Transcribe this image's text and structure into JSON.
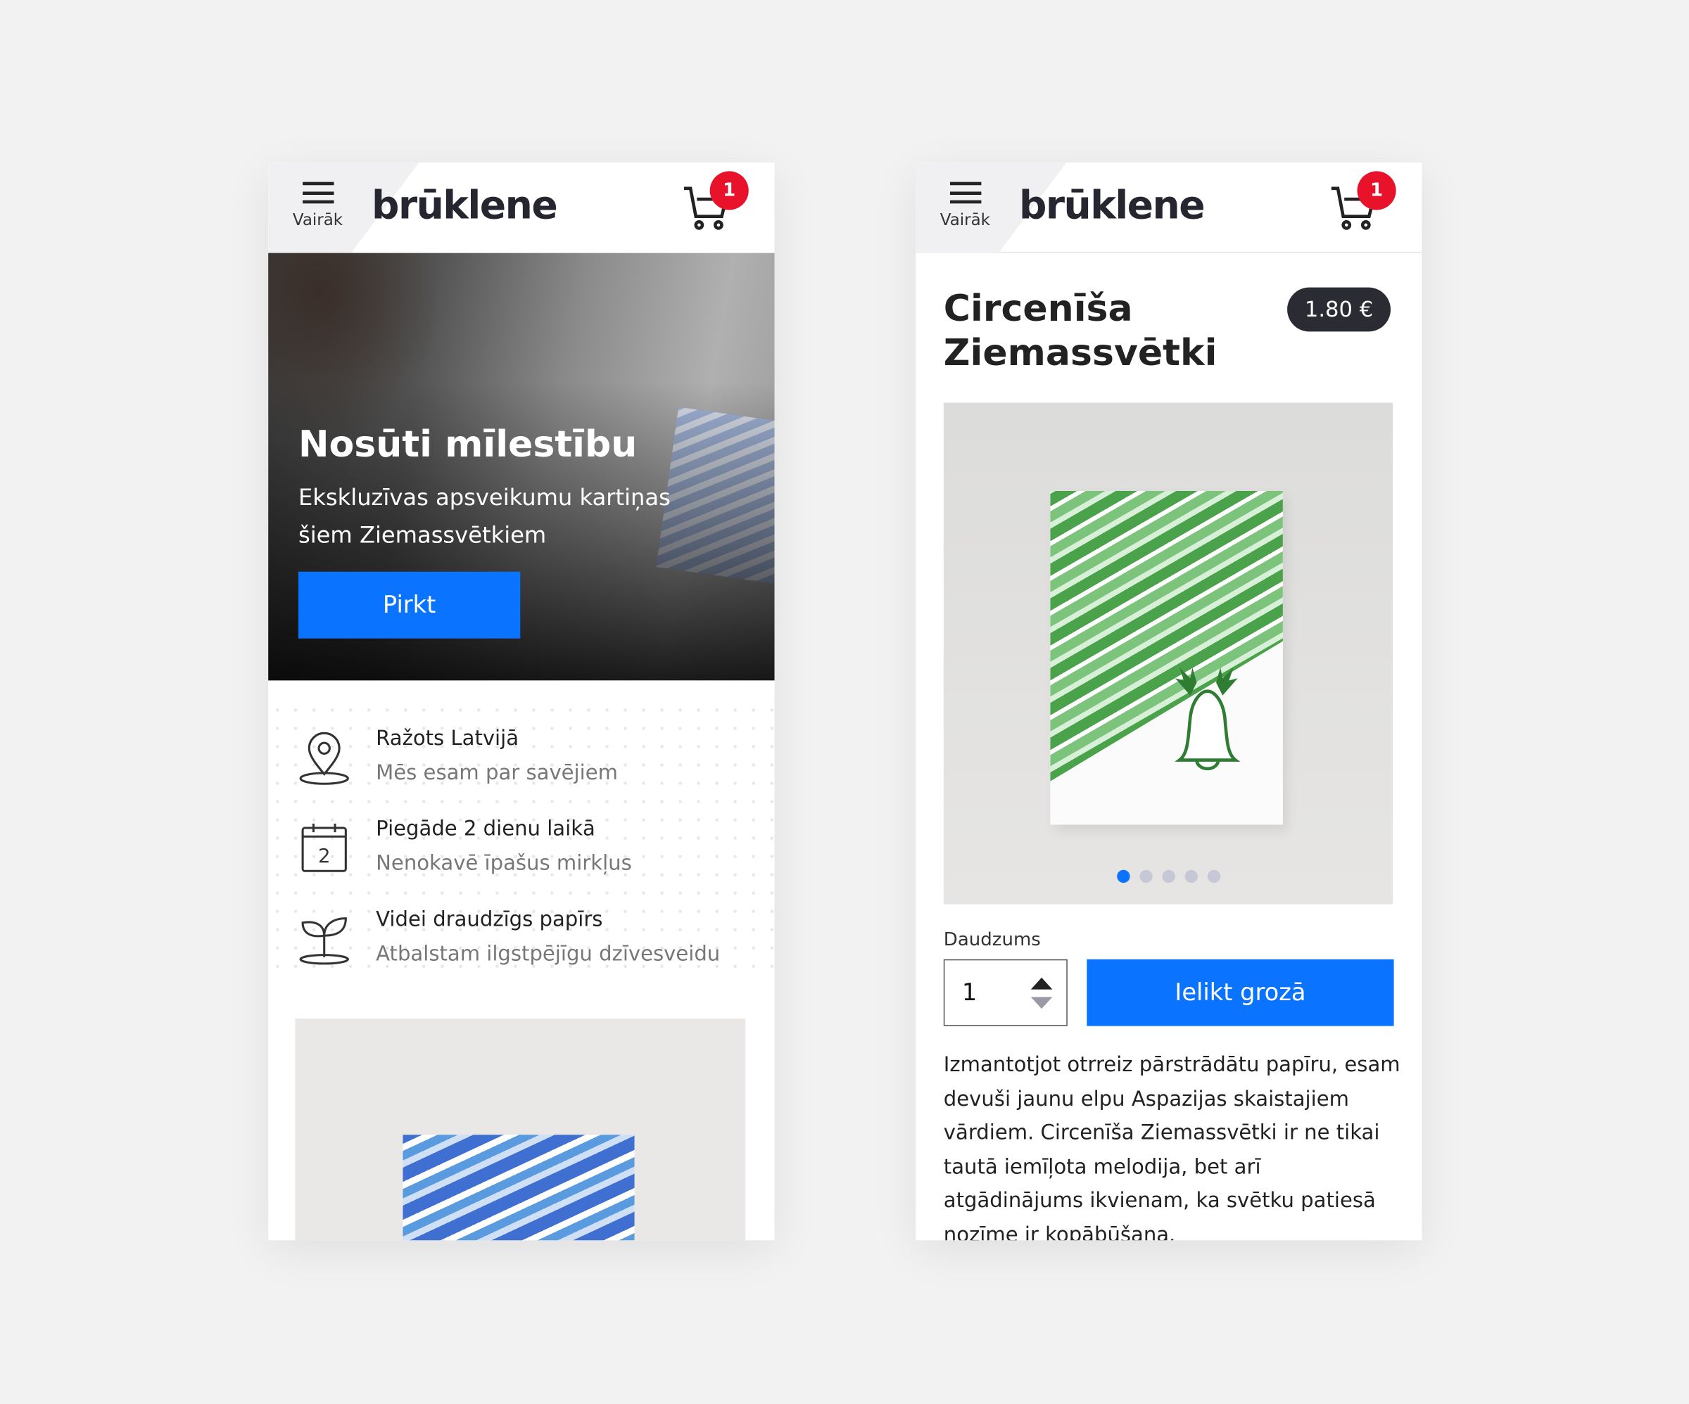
{
  "header": {
    "menu_label": "Vairāk",
    "logo": "brūklene",
    "cart_count": "1"
  },
  "home": {
    "hero": {
      "title": "Nosūti mīlestību",
      "subtitle": "Ekskluzīvas apsveikumu kartiņas šiem Ziemassvētkiem",
      "button": "Pirkt"
    },
    "features": [
      {
        "icon": "location-pin-icon",
        "title": "Ražots Latvijā",
        "desc": "Mēs esam par savējiem"
      },
      {
        "icon": "calendar-icon",
        "title": "Piegāde 2 dienu laikā",
        "desc": "Nenokavē īpašus mirkļus",
        "calendar_day": "2"
      },
      {
        "icon": "sprout-icon",
        "title": "Videi draudzīgs papīrs",
        "desc": "Atbalstam ilgstpējīgu dzīvesveidu"
      }
    ]
  },
  "product": {
    "title": "Circenīša Ziemassvētki",
    "price": "1.80 €",
    "gallery": {
      "count": 5,
      "active": 0
    },
    "quantity_label": "Daudzums",
    "quantity": "1",
    "add_button": "Ielikt grozā",
    "description": "Izmantotjot otrreiz pārstrādātu papīru, esam devuši jaunu elpu Aspazijas skaistajiem vārdiem. Circenīša Ziemassvētki ir ne tikai tautā iemīļota melodija, bet arī atgādinājums ikvienam, ka svētku patiesā nozīme ir kopābūšana.",
    "accent": "#0a73ff"
  }
}
